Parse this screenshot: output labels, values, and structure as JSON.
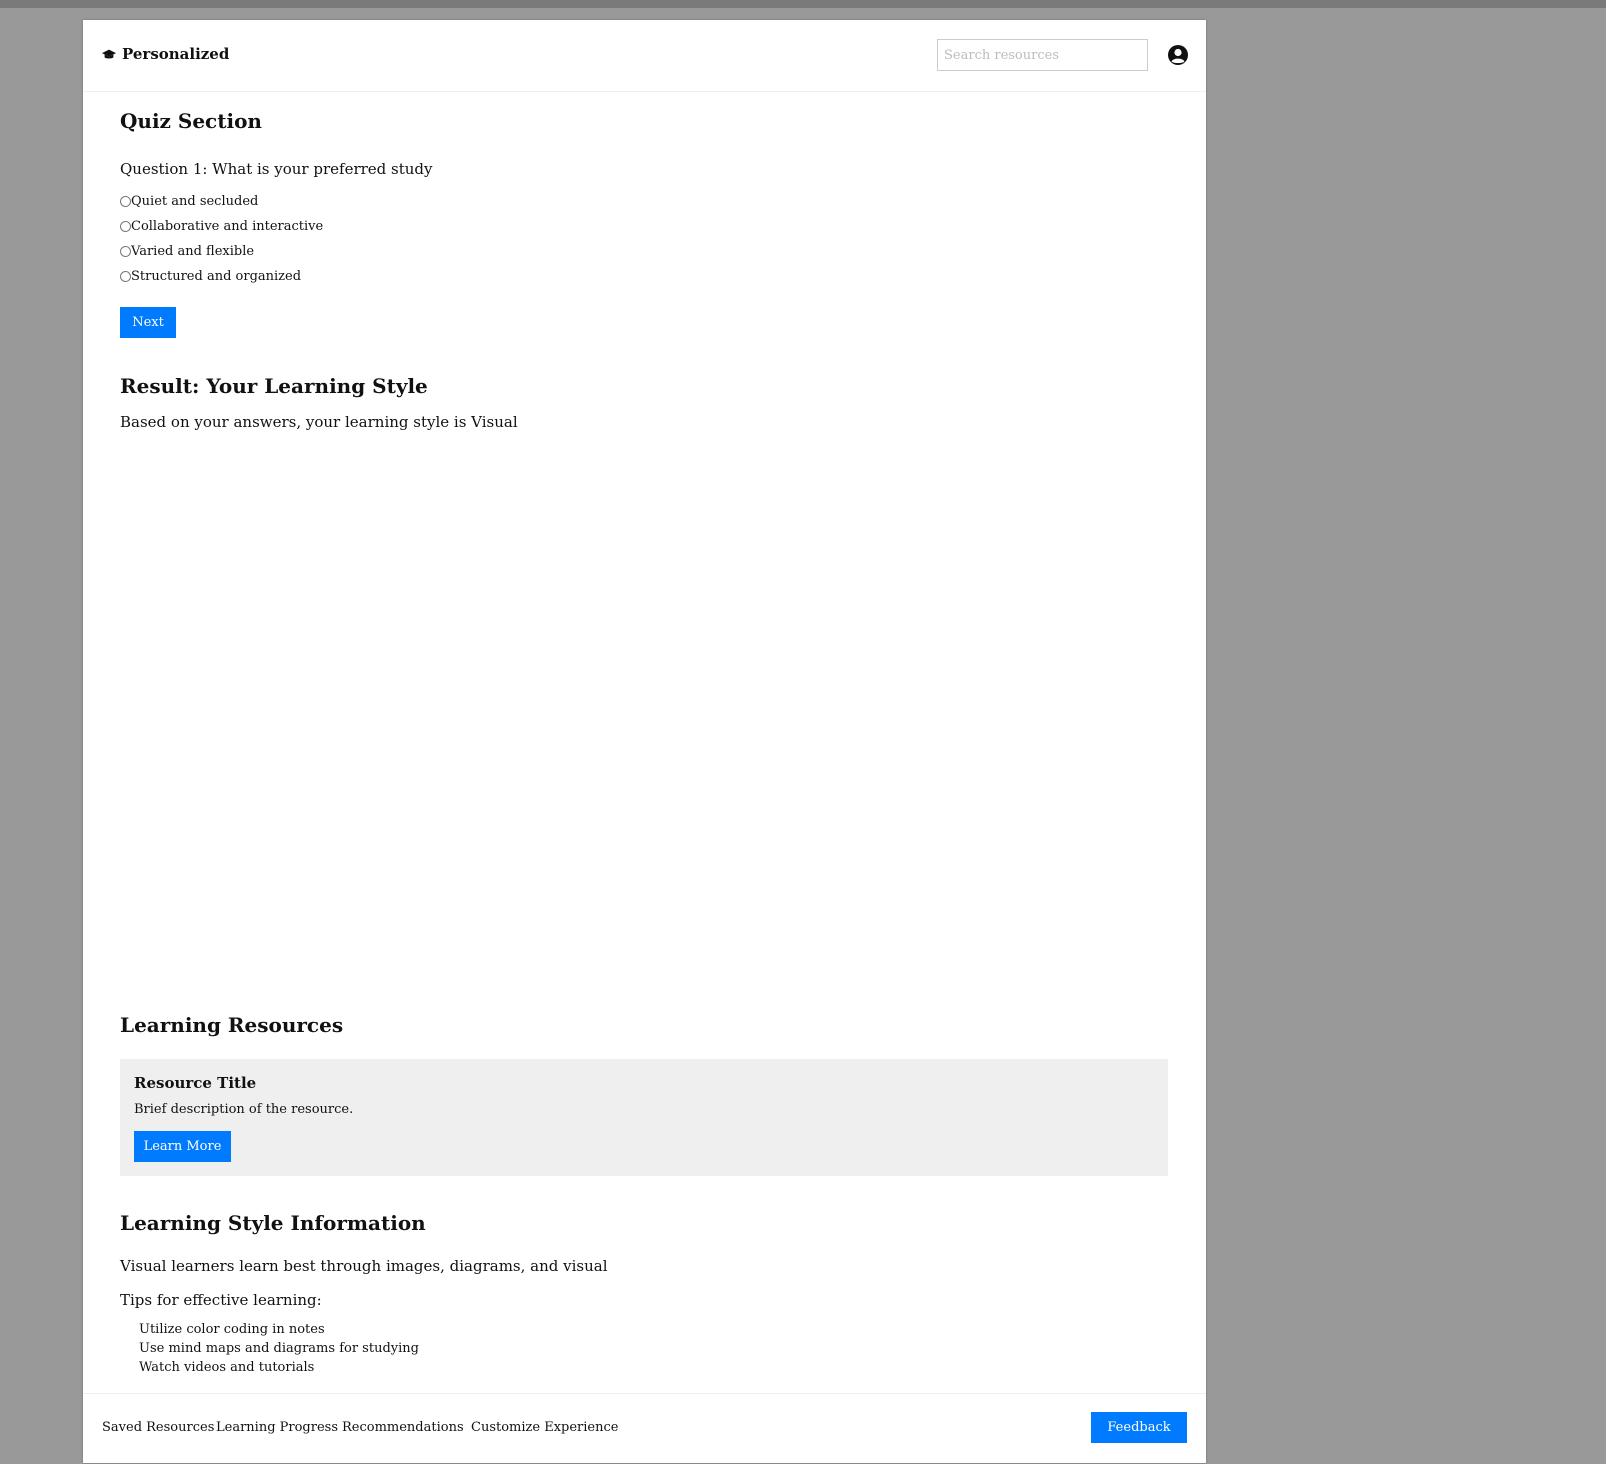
{
  "header": {
    "brand": "Personalized",
    "brand_icon": "graduation-cap-icon",
    "search_placeholder": "Search resources",
    "user_icon": "user-circle-icon"
  },
  "quiz": {
    "title": "Quiz Section",
    "question": "Question 1: What is your preferred study",
    "options": [
      "Quiet and secluded",
      "Collaborative and interactive",
      "Varied and flexible",
      "Structured and organized"
    ],
    "next_label": "Next"
  },
  "result": {
    "title": "Result: Your Learning Style",
    "text": "Based on your answers, your learning style is Visual"
  },
  "resources": {
    "title": "Learning Resources",
    "card": {
      "title": "Resource Title",
      "description": "Brief description of the resource.",
      "button_label": "Learn More"
    }
  },
  "style_info": {
    "title": "Learning Style Information",
    "description": "Visual learners learn best through images, diagrams, and visual",
    "tips_heading": "Tips for effective learning:",
    "tips": [
      "Utilize color coding in notes",
      "Use mind maps and diagrams for studying",
      "Watch videos and tutorials"
    ]
  },
  "footer": {
    "links": [
      "Saved Resources",
      "Learning Progress",
      "Recommendations",
      "Customize Experience"
    ],
    "feedback_label": "Feedback"
  },
  "colors": {
    "accent": "#007bff",
    "card_background": "#efefef",
    "backdrop": "#999999"
  }
}
